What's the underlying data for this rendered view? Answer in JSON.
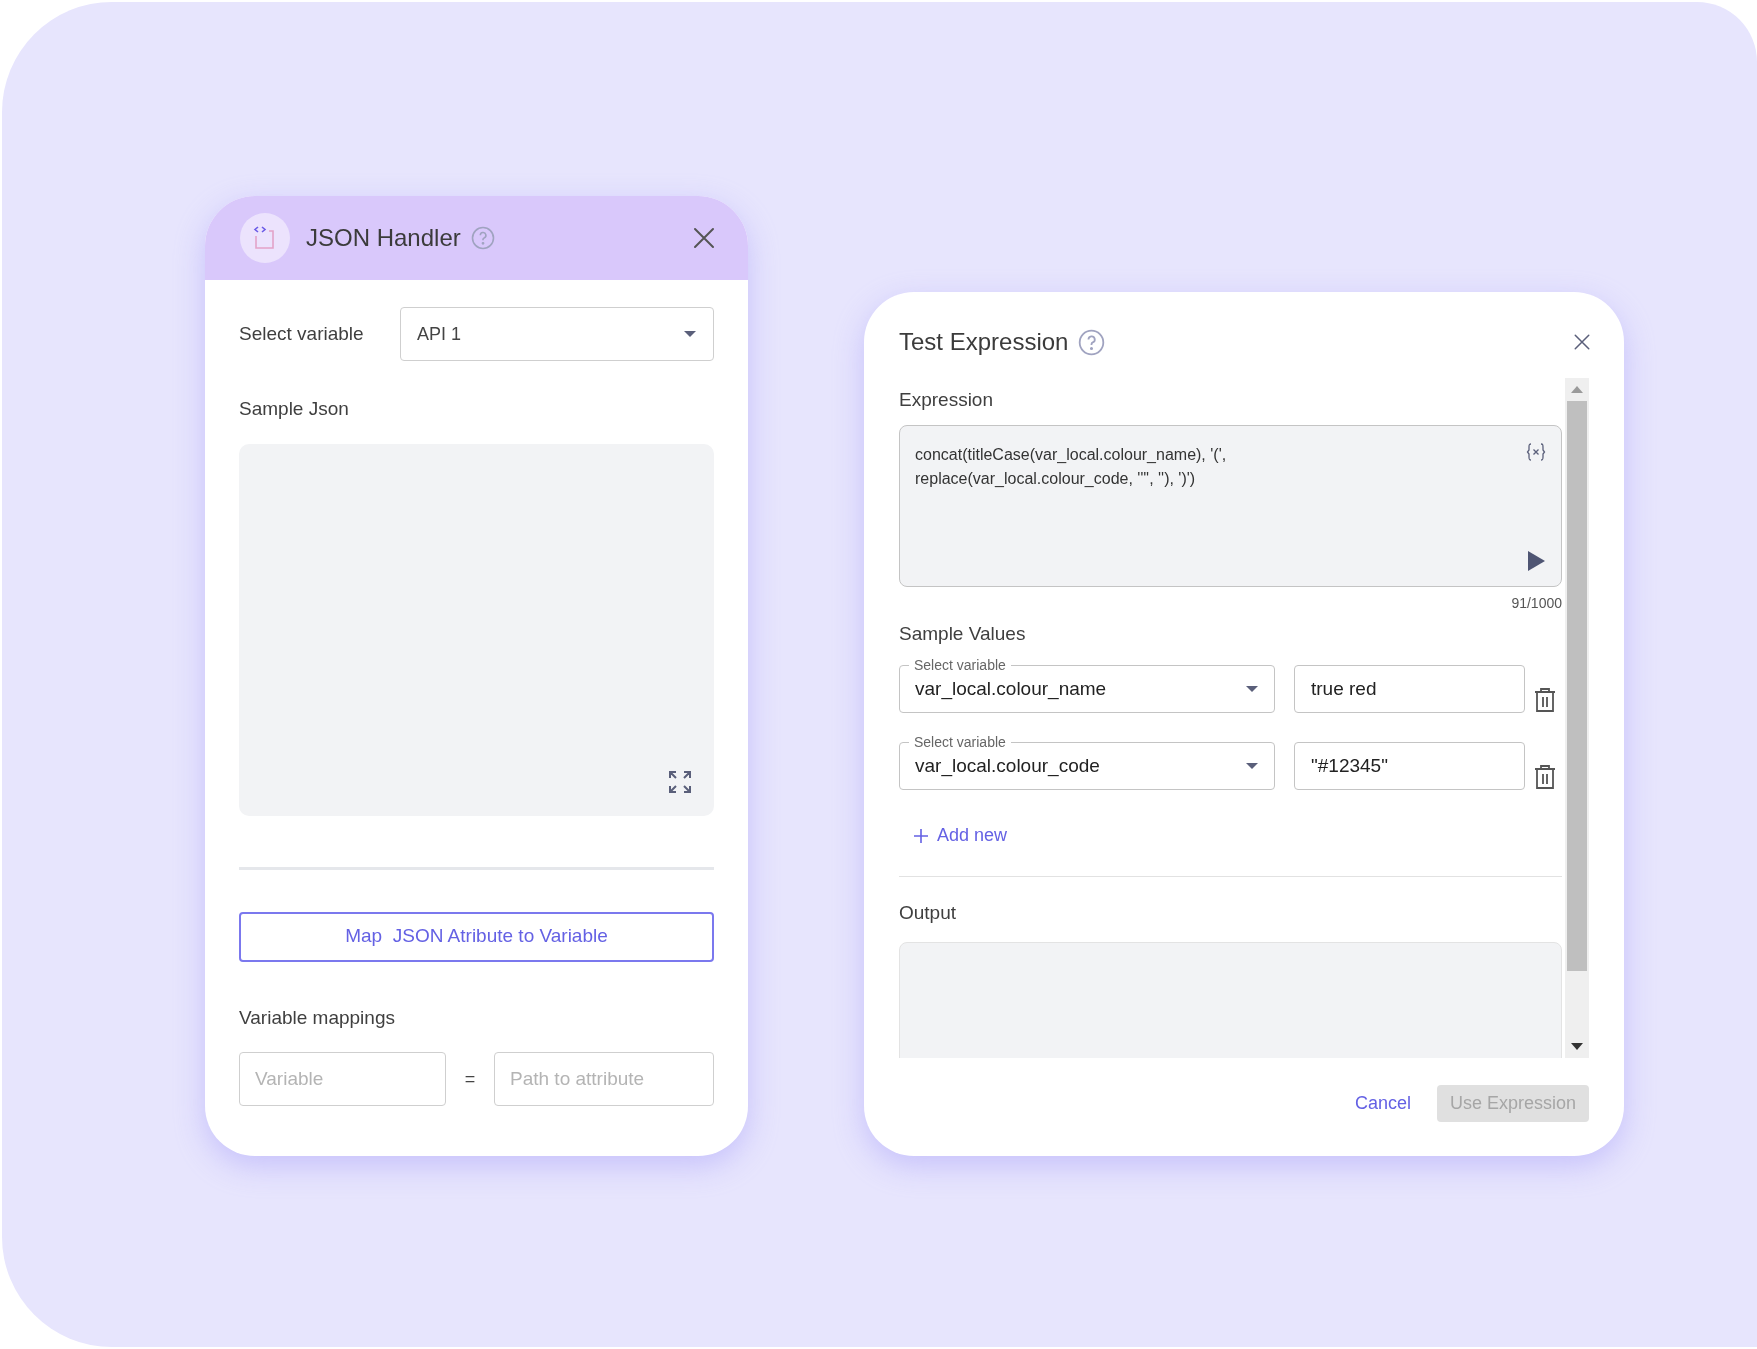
{
  "json_handler": {
    "title": "JSON Handler",
    "select_variable": {
      "label": "Select variable",
      "value": "API 1"
    },
    "sample_json": {
      "label": "Sample Json"
    },
    "map_button": "Map  JSON Atribute to Variable",
    "variable_mappings": {
      "label": "Variable mappings",
      "separator": "=",
      "variable": {
        "placeholder": "Variable"
      },
      "path": {
        "placeholder": "Path to attribute"
      }
    }
  },
  "test_expression": {
    "title": "Test Expression",
    "expression": {
      "label": "Expression",
      "value": "concat(titleCase(var_local.colour_name), '(', replace(var_local.colour_code, '\"', ''), ')')",
      "counter": "91/1000"
    },
    "sample_values": {
      "label": "Sample Values",
      "rows": [
        {
          "label": "Select variable",
          "variable": "var_local.colour_name",
          "value": "true red"
        },
        {
          "label": "Select variable",
          "variable": "var_local.colour_code",
          "value": "\"#12345\""
        }
      ],
      "add_button": "Add new"
    },
    "output": {
      "label": "Output"
    },
    "buttons": [
      {
        "label": "Cancel",
        "kind": "text",
        "disabled": false
      },
      {
        "label": "Use Expression",
        "kind": "filled",
        "disabled": true
      }
    ]
  }
}
